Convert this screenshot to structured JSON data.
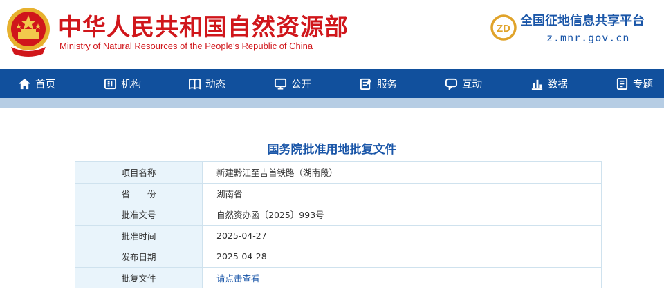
{
  "header": {
    "title_cn": "中华人民共和国自然资源部",
    "title_en": "Ministry of Natural Resources of the People’s Republic of China",
    "platform_logo_text": "ZD",
    "platform_name": "全国征地信息共享平台",
    "platform_url": "z.mnr.gov.cn"
  },
  "nav": {
    "items": [
      {
        "label": "首页",
        "icon": "home-icon"
      },
      {
        "label": "机构",
        "icon": "organization-icon"
      },
      {
        "label": "动态",
        "icon": "book-icon"
      },
      {
        "label": "公开",
        "icon": "monitor-icon"
      },
      {
        "label": "服务",
        "icon": "edit-document-icon"
      },
      {
        "label": "互动",
        "icon": "chat-icon"
      },
      {
        "label": "数据",
        "icon": "bar-chart-icon"
      },
      {
        "label": "专题",
        "icon": "topic-book-icon"
      }
    ]
  },
  "document": {
    "title": "国务院批准用地批复文件",
    "rows": [
      {
        "label": "项目名称",
        "value": "新建黔江至吉首铁路（湖南段）"
      },
      {
        "label": "省　　份",
        "value": "湖南省"
      },
      {
        "label": "批准文号",
        "value": "自然资办函〔2025〕993号"
      },
      {
        "label": "批准时间",
        "value": "2025-04-27"
      },
      {
        "label": "发布日期",
        "value": "2025-04-28"
      },
      {
        "label": "批复文件",
        "value": "请点击查看"
      }
    ]
  },
  "colors": {
    "brand_red": "#d0161b",
    "nav_blue": "#11509d",
    "link_blue": "#1a56a8",
    "label_bg": "#e9f4fb"
  }
}
